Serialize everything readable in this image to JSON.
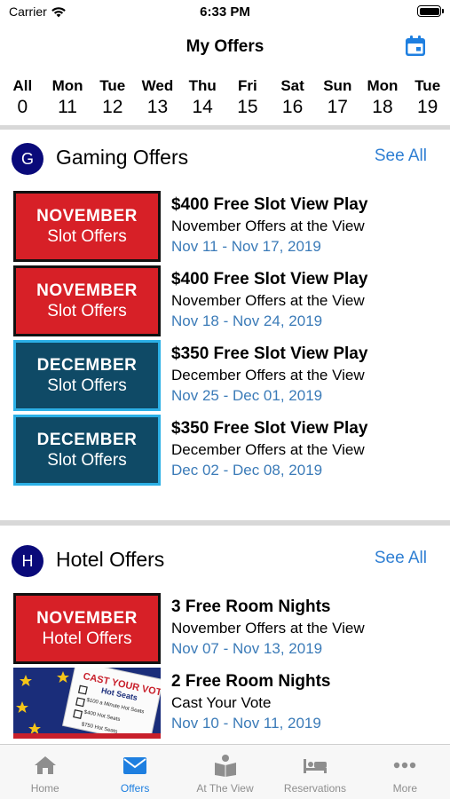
{
  "status": {
    "carrier": "Carrier",
    "time": "6:33 PM"
  },
  "nav": {
    "title": "My Offers"
  },
  "days": [
    {
      "name": "All",
      "num": "0"
    },
    {
      "name": "Mon",
      "num": "11"
    },
    {
      "name": "Tue",
      "num": "12"
    },
    {
      "name": "Wed",
      "num": "13"
    },
    {
      "name": "Thu",
      "num": "14"
    },
    {
      "name": "Fri",
      "num": "15"
    },
    {
      "name": "Sat",
      "num": "16"
    },
    {
      "name": "Sun",
      "num": "17"
    },
    {
      "name": "Mon",
      "num": "18"
    },
    {
      "name": "Tue",
      "num": "19"
    }
  ],
  "gaming": {
    "badge": "G",
    "title": "Gaming Offers",
    "see_all": "See All",
    "offers": [
      {
        "thumb_line1": "NOVEMBER",
        "thumb_line2": "Slot Offers",
        "title": "$400 Free Slot View Play",
        "subtitle": "November Offers at the View",
        "dates": "Nov 11 - Nov 17, 2019"
      },
      {
        "thumb_line1": "NOVEMBER",
        "thumb_line2": "Slot Offers",
        "title": "$400 Free Slot View Play",
        "subtitle": "November Offers at the View",
        "dates": "Nov 18 - Nov 24, 2019"
      },
      {
        "thumb_line1": "DECEMBER",
        "thumb_line2": "Slot Offers",
        "title": "$350 Free Slot View Play",
        "subtitle": "December Offers at the View",
        "dates": "Nov 25 - Dec 01, 2019"
      },
      {
        "thumb_line1": "DECEMBER",
        "thumb_line2": "Slot Offers",
        "title": "$350 Free Slot View Play",
        "subtitle": "December Offers at the View",
        "dates": "Dec 02 - Dec 08, 2019"
      }
    ]
  },
  "hotel": {
    "badge": "H",
    "title": "Hotel Offers",
    "see_all": "See All",
    "offers": [
      {
        "thumb_line1": "NOVEMBER",
        "thumb_line2": "Hotel Offers",
        "title": "3 Free Room Nights",
        "subtitle": "November Offers at the View",
        "dates": "Nov 07 - Nov 13, 2019"
      },
      {
        "thumb_line1": "CAST YOUR VOTE!",
        "thumb_line2": "Hot Seats",
        "thumb_items": [
          "$100 a Minute Hot Seats",
          "$400 Hot Seats",
          "$750 Hot Seats"
        ],
        "title": "2 Free Room Nights",
        "subtitle": "Cast Your Vote",
        "dates": "Nov 10 - Nov 11, 2019"
      }
    ]
  },
  "tabs": [
    {
      "label": "Home",
      "icon": "home-icon"
    },
    {
      "label": "Offers",
      "icon": "envelope-icon"
    },
    {
      "label": "At The View",
      "icon": "book-reader-icon"
    },
    {
      "label": "Reservations",
      "icon": "bed-icon"
    },
    {
      "label": "More",
      "icon": "more-dots-icon"
    }
  ],
  "colors": {
    "accent": "#1e7fe0",
    "link": "#2f7fd3",
    "date": "#3b7bb8",
    "badge": "#0a0a7a",
    "red_thumb": "#d72027",
    "blue_thumb": "#0f4a66"
  }
}
